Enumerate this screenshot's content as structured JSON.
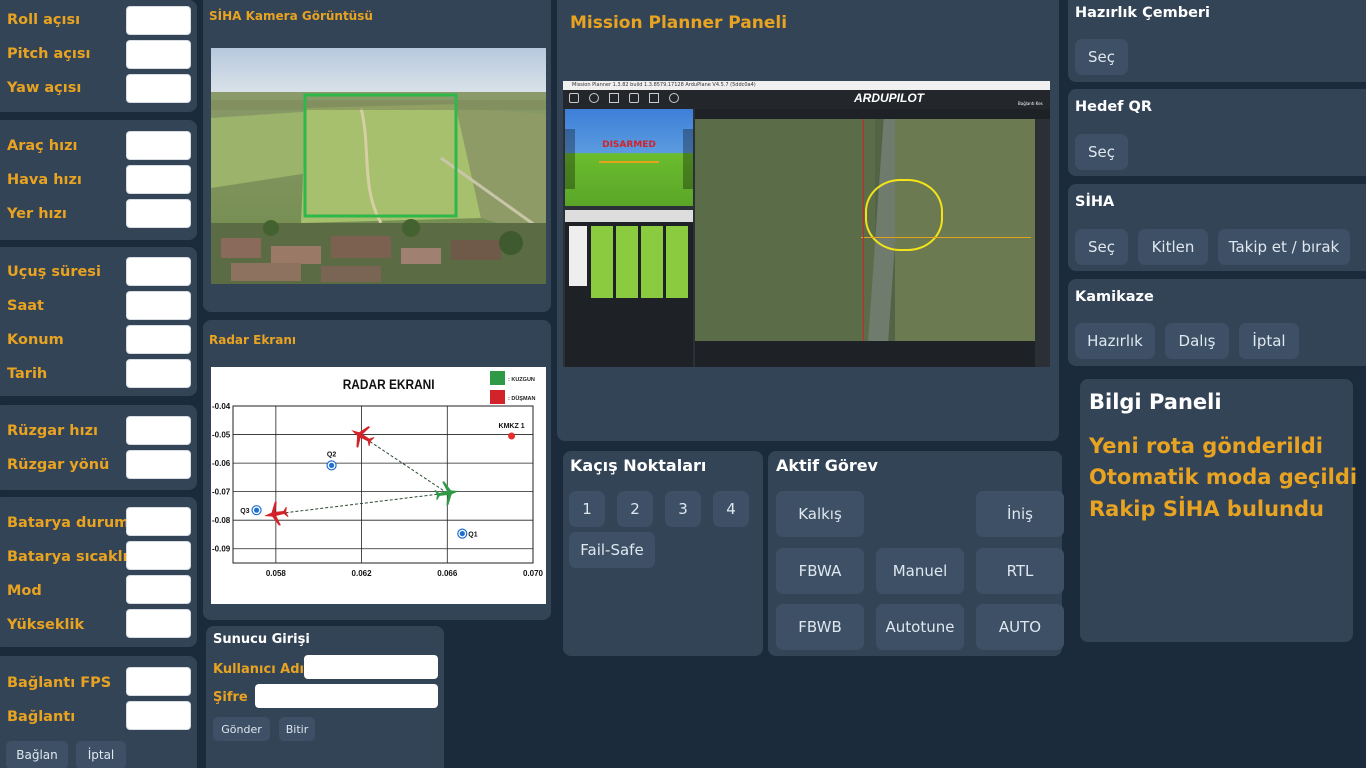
{
  "telemetry": {
    "roll_label": "Roll açısı",
    "pitch_label": "Pitch açısı",
    "yaw_label": "Yaw açısı",
    "vehicle_speed_label": "Araç hızı",
    "air_speed_label": "Hava hızı",
    "ground_speed_label": "Yer hızı",
    "flight_time_label": "Uçuş süresi",
    "clock_label": "Saat",
    "position_label": "Konum",
    "date_label": "Tarih",
    "wind_speed_label": "Rüzgar hızı",
    "wind_direction_label": "Rüzgar yönü",
    "battery_status_label": "Batarya durumu",
    "battery_temp_label": "Batarya sıcaklığı",
    "mode_label": "Mod",
    "altitude_label": "Yükseklik",
    "fps_label": "Bağlantı FPS",
    "connection_label": "Bağlantı",
    "connect_button": "Bağlan",
    "cancel_button": "İptal"
  },
  "camera": {
    "title": "SİHA Kamera Görüntüsü"
  },
  "radar": {
    "panel_title": "Radar Ekranı"
  },
  "chart_data": {
    "type": "scatter",
    "title": "RADAR EKRANI",
    "xlim": [
      0.056,
      0.07
    ],
    "ylim": [
      -0.095,
      -0.04
    ],
    "xticks": [
      "0.058",
      "0.062",
      "0.066",
      "0.070"
    ],
    "yticks": [
      "-0.04",
      "-0.05",
      "-0.06",
      "-0.07",
      "-0.08",
      "-0.09"
    ],
    "grid": true,
    "legend": [
      {
        "label": ": KUZGUN",
        "color": "#2e9a46"
      },
      {
        "label": ": DÜŞMAN",
        "color": "#d2232a"
      }
    ],
    "legend_position": "top-right",
    "aircraft": [
      {
        "role": "friendly",
        "x": 0.066,
        "y": -0.0705,
        "color": "#2e9a46"
      },
      {
        "role": "enemy",
        "x": 0.062,
        "y": -0.0505,
        "color": "#d2232a"
      },
      {
        "role": "enemy",
        "x": 0.058,
        "y": -0.0778,
        "color": "#d2232a"
      }
    ],
    "links": [
      [
        0,
        1
      ],
      [
        0,
        2
      ]
    ],
    "points": [
      {
        "label": "Q1",
        "x": 0.0667,
        "y": -0.0847,
        "color": "#1f6fd1"
      },
      {
        "label": "Q2",
        "x": 0.0606,
        "y": -0.0608,
        "color": "#1f6fd1"
      },
      {
        "label": "Q3",
        "x": 0.0571,
        "y": -0.0765,
        "color": "#1f6fd1"
      },
      {
        "label": "KMKZ 1",
        "x": 0.069,
        "y": -0.0505,
        "color": "#e5302d"
      }
    ]
  },
  "server": {
    "title": "Sunucu Girişi",
    "username_label": "Kullanıcı Adı",
    "password_label": "Şifre",
    "username_value": "",
    "password_value": "",
    "send_button": "Gönder",
    "finish_button": "Bitir"
  },
  "mission_planner": {
    "title": "Mission Planner Paneli",
    "window_title": "Mission Planner 1.3.82 build 1.3.8579.17128 ArduPlane V4.5.7 (5ddc0a4)",
    "hud_status": "DISARMED",
    "brand": "ARDUPILOT",
    "connect_label": "Bağlantı Kes"
  },
  "escape": {
    "title": "Kaçış Noktaları",
    "points": [
      "1",
      "2",
      "3",
      "4"
    ],
    "failsafe": "Fail-Safe"
  },
  "task": {
    "title": "Aktif Görev",
    "buttons": [
      "Kalkış",
      "İniş",
      "FBWA",
      "Manuel",
      "RTL",
      "FBWB",
      "Autotune",
      "AUTO"
    ]
  },
  "right": {
    "ready_title": "Hazırlık Çemberi",
    "ready_select": "Seç",
    "qr_title": "Hedef QR",
    "qr_select": "Seç",
    "siha_title": "SİHA",
    "siha_select": "Seç",
    "siha_lock": "Kitlen",
    "siha_follow": "Takip et / bırak",
    "kamikaze_title": "Kamikaze",
    "kamikaze_prep": "Hazırlık",
    "kamikaze_dive": "Dalış",
    "kamikaze_cancel": "İptal"
  },
  "info": {
    "title": "Bilgi Paneli",
    "messages": [
      "Yeni rota gönderildi",
      "Otomatik moda geçildi",
      "Rakip SİHA bulundu"
    ]
  }
}
